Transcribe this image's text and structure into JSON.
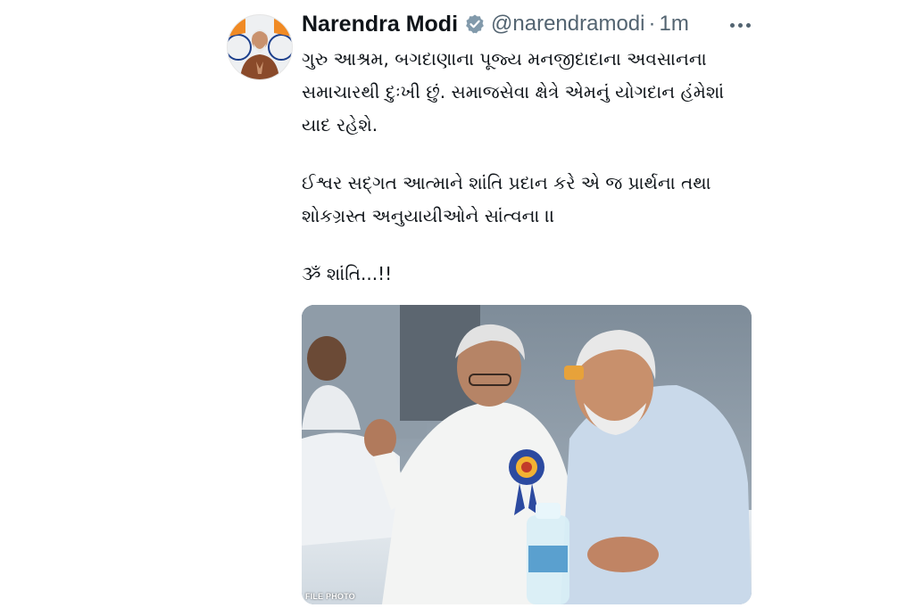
{
  "tweet": {
    "author_name": "Narendra Modi",
    "handle": "@narendramodi",
    "separator": "·",
    "time": "1m",
    "verified_color": "#829aab",
    "text_paragraphs": [
      "ગુરુ આશ્રમ, બગદાણાના પૂજ્ય મનજીદાદાના અવસાનના સમાચારથી દુઃખી છું. સમાજસેવા ક્ષેત્રે એમનું યોગદાન હંમેશાં યાદ રહેશે.",
      "ઈશ્વર સદ્ગત આત્માને શાંતિ પ્રદાન કરે એ જ પ્રાર્થના તથા શોકગ્રસ્ત અનુયાયીઓને સાંત્વના ।।",
      "ૐ શાંતિ...!!"
    ],
    "photo_label": "FILE PHOTO"
  },
  "icons": {
    "verified": "verified-badge-icon",
    "more": "more-options-icon"
  }
}
